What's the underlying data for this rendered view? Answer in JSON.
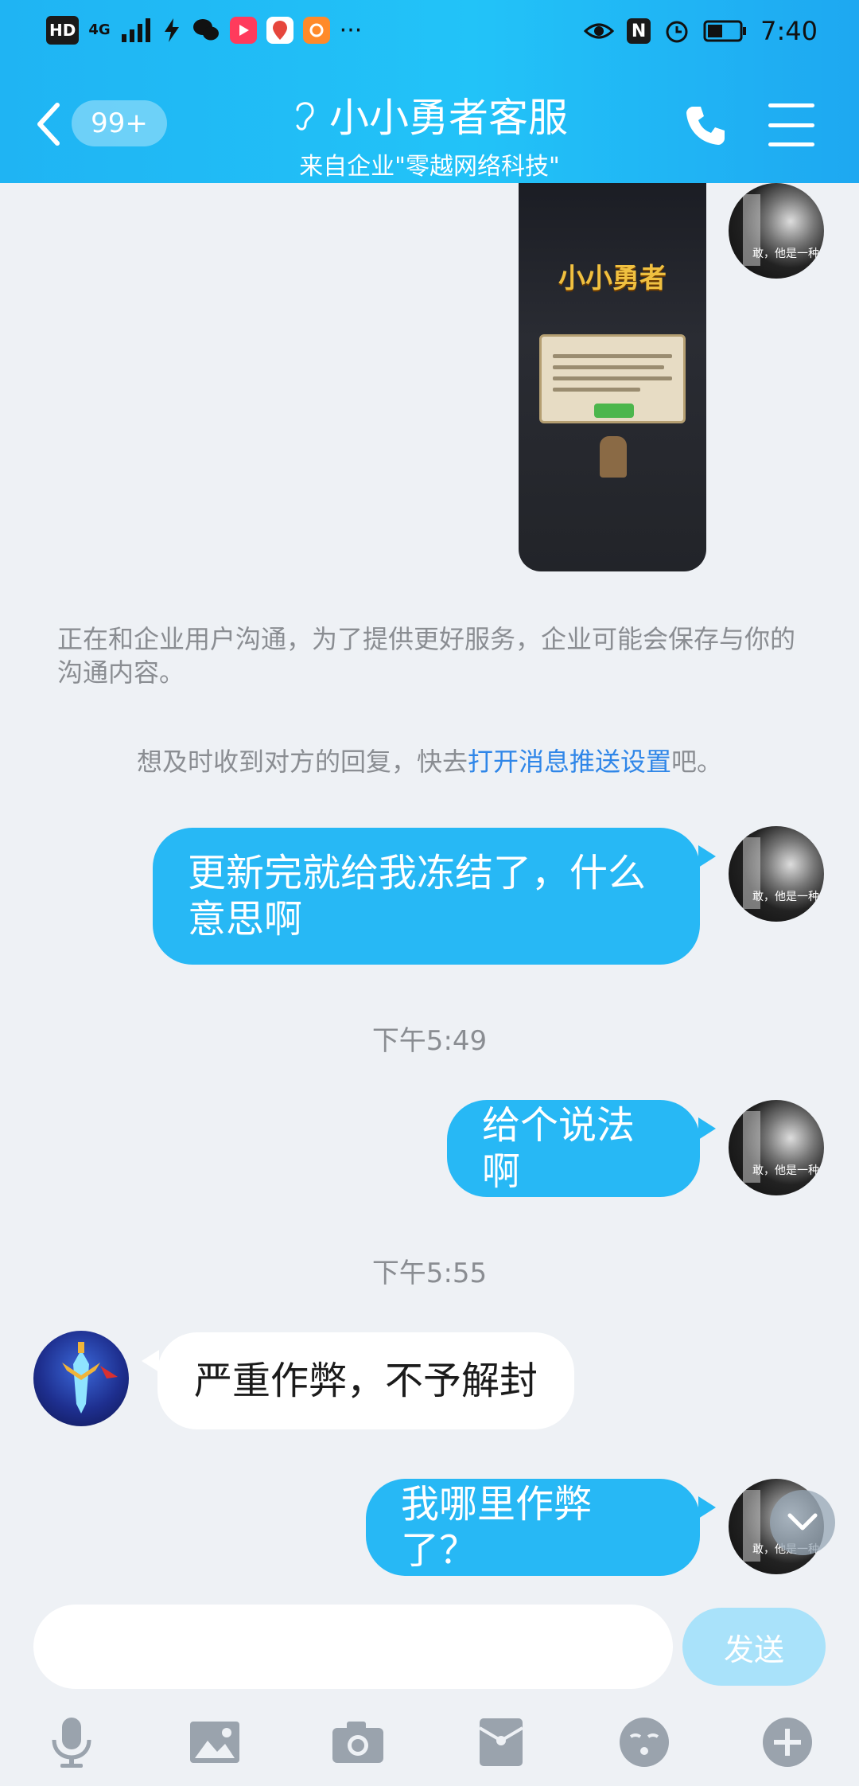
{
  "status_bar": {
    "left_badges": [
      "HD",
      "4G"
    ],
    "more": "···",
    "time": "7:40",
    "nfc_label": "N"
  },
  "header": {
    "unread": "99+",
    "title": "小小勇者客服",
    "subtitle": "来自企业\"零越网络科技\""
  },
  "image_message": {
    "game_title": "小小勇者"
  },
  "notices": {
    "privacy": "正在和企业用户沟通，为了提供更好服务，企业可能会保存与你的沟通内容。",
    "push_prefix": "想及时收到对方的回复，快去",
    "push_link": "打开消息推送设置",
    "push_suffix": "吧。"
  },
  "messages": {
    "m1": "更新完就给我冻结了，什么意思啊",
    "t1": "下午5:49",
    "m2": "给个说法啊",
    "t2": "下午5:55",
    "m3": "严重作弊，不予解封",
    "m4": "我哪里作弊了？"
  },
  "avatar_caption": "敢，他是一种",
  "input": {
    "placeholder": "",
    "send_label": "发送"
  },
  "colors": {
    "header_gradient": "#1fb4f3",
    "my_bubble": "#27b8f5",
    "link": "#2f86e8"
  }
}
